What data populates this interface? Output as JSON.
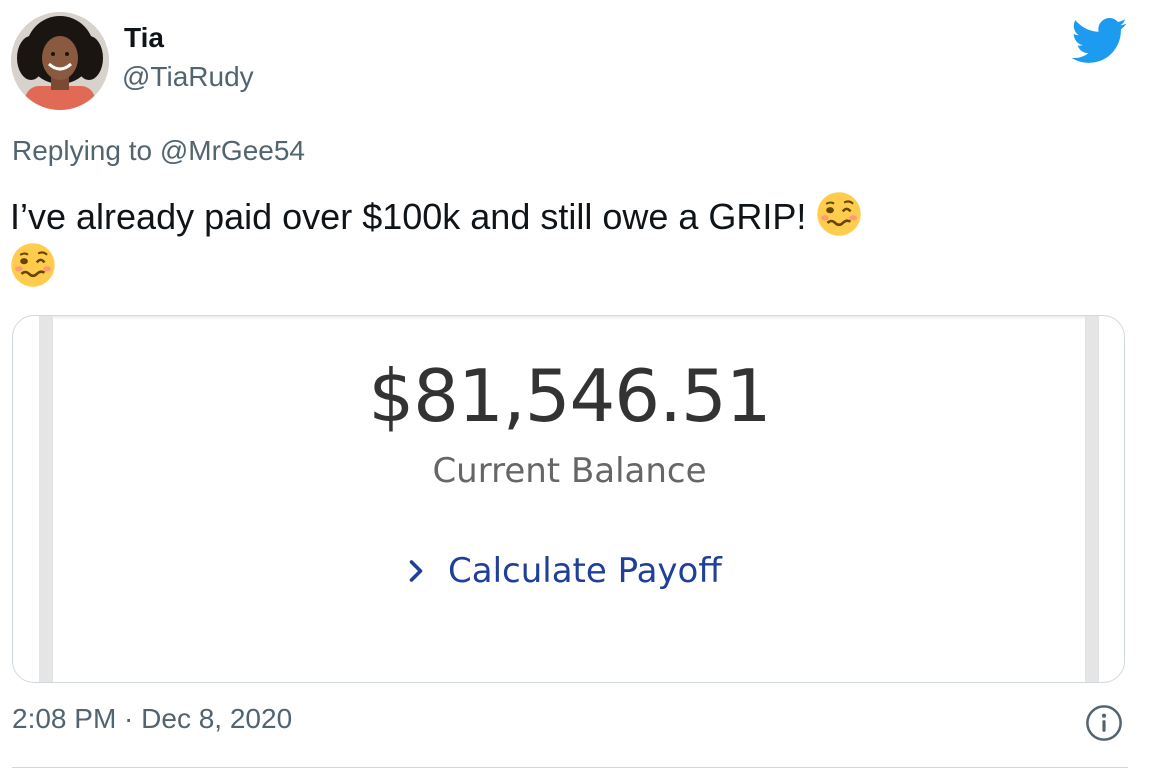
{
  "tweet": {
    "author": {
      "name": "Tia",
      "handle": "@TiaRudy"
    },
    "replying_to": "Replying to @MrGee54",
    "text": "I’ve already paid over $100k and still owe a GRIP!",
    "emojis": [
      "woozy-face",
      "woozy-face"
    ],
    "timestamp": "2:08 PM · Dec 8, 2020"
  },
  "card": {
    "amount": "$81,546.51",
    "label": "Current Balance",
    "link_label": "Calculate Payoff"
  },
  "icons": {
    "brand": "twitter-bird-icon",
    "info": "info-icon",
    "chevron": "chevron-right-icon"
  },
  "colors": {
    "twitter_blue": "#1d9bf0",
    "link_blue": "#1f3f9a",
    "secondary_text": "#536471"
  }
}
